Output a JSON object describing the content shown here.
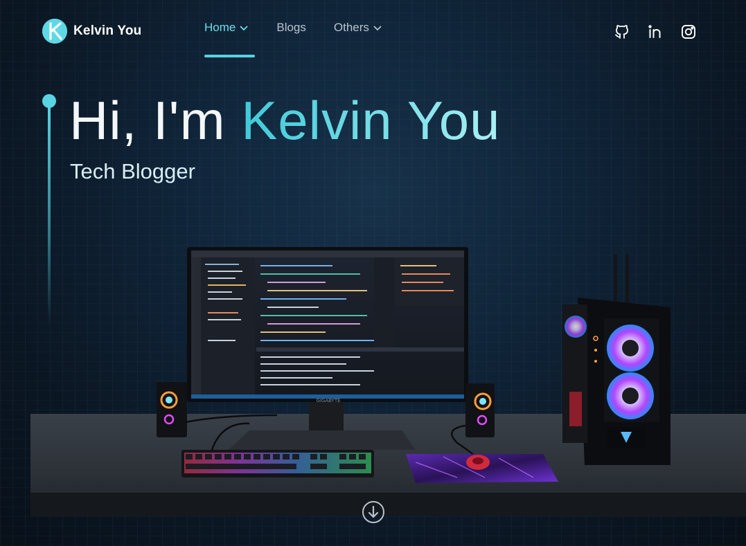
{
  "brand": {
    "name": "Kelvin You",
    "logo_letter": "K",
    "accent": "#55d3e1"
  },
  "nav": {
    "items": [
      {
        "label": "Home",
        "has_dropdown": true,
        "active": true
      },
      {
        "label": "Blogs",
        "has_dropdown": false,
        "active": false
      },
      {
        "label": "Others",
        "has_dropdown": true,
        "active": false
      }
    ]
  },
  "social": [
    "github-icon",
    "linkedin-icon",
    "instagram-icon"
  ],
  "hero": {
    "greeting": "Hi, I'm ",
    "name": "Kelvin You",
    "subtitle": "Tech Blogger"
  },
  "scene": {
    "monitor_brand": "GIGABYTE"
  },
  "scroll_icon": "arrow-down-circle-icon"
}
